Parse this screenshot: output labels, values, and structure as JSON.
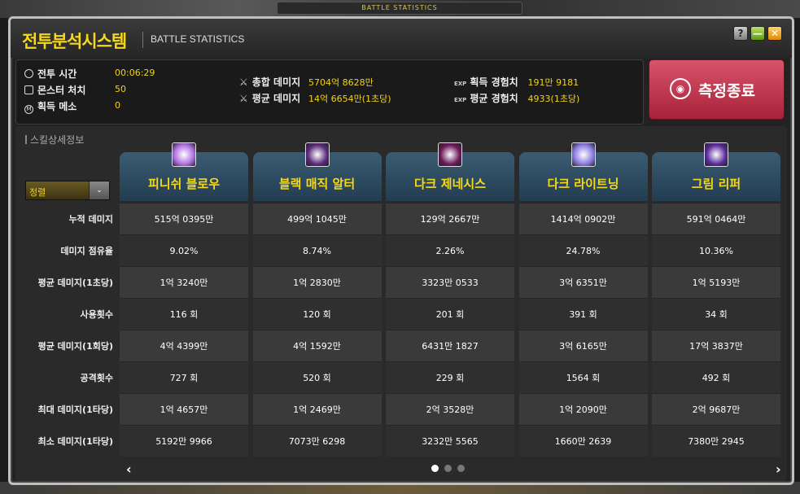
{
  "background": {
    "tab_text": "BATTLE STATISTICS"
  },
  "window": {
    "title_ko": "전투분석시스템",
    "title_en": "BATTLE STATISTICS",
    "help_label": "?",
    "min_label": "—",
    "close_label": "✕"
  },
  "summary": {
    "battle_time_label": "전투 시간",
    "battle_time": "00:06:29",
    "monster_kills_label": "몬스터 처치",
    "monster_kills": "50",
    "meso_label": "획득 메소",
    "meso": "0",
    "total_damage_label": "총합 데미지",
    "total_damage": "5704억 8628만",
    "avg_damage_label": "평균 데미지",
    "avg_damage": "14억 6654만(1초당)",
    "exp_gained_label": "획득 경험치",
    "exp_gained": "191만 9181",
    "avg_exp_label": "평균 경험치",
    "avg_exp": "4933(1초당)",
    "exp_tag": "EXP",
    "meso_icon": "M"
  },
  "end_button": {
    "label": "측정종료"
  },
  "detail": {
    "title": "스킬상세정보",
    "sort_label": "정렬",
    "row_labels": [
      "누적 데미지",
      "데미지 점유율",
      "평균 데미지(1초당)",
      "사용횟수",
      "평균 데미지(1회당)",
      "공격횟수",
      "최대 데미지(1타당)",
      "최소 데미지(1타당)"
    ],
    "skills": [
      {
        "name": "피니쉬 블로우",
        "icon_color": "#b070e0",
        "values": [
          "515억 0395만",
          "9.02%",
          "1억 3240만",
          "116 회",
          "4억 4399만",
          "727 회",
          "1억 4657만",
          "5192만 9966"
        ]
      },
      {
        "name": "블랙 매직 알터",
        "icon_color": "#5a2a7a",
        "values": [
          "499억 1045만",
          "8.74%",
          "1억 2830만",
          "120 회",
          "4억 1592만",
          "520 회",
          "1억 2469만",
          "7073만 6298"
        ]
      },
      {
        "name": "다크 제네시스",
        "icon_color": "#6a1a5a",
        "values": [
          "129억 2667만",
          "2.26%",
          "3323만 0533",
          "201 회",
          "6431만 1827",
          "229 회",
          "2억 3528만",
          "3232만 5565"
        ]
      },
      {
        "name": "다크 라이트닝",
        "icon_color": "#8a7ae0",
        "values": [
          "1414억 0902만",
          "24.78%",
          "3억 6351만",
          "391 회",
          "3억 6165만",
          "1564 회",
          "1억 2090만",
          "1660만 2639"
        ]
      },
      {
        "name": "그림 리퍼",
        "icon_color": "#5a2a9a",
        "values": [
          "591억 0464만",
          "10.36%",
          "1억 5193만",
          "34 회",
          "17억 3837만",
          "492 회",
          "2억 9687만",
          "7380만 2945"
        ]
      }
    ],
    "prev_label": "‹",
    "next_label": "›",
    "page_count": 3,
    "current_page": 1
  }
}
